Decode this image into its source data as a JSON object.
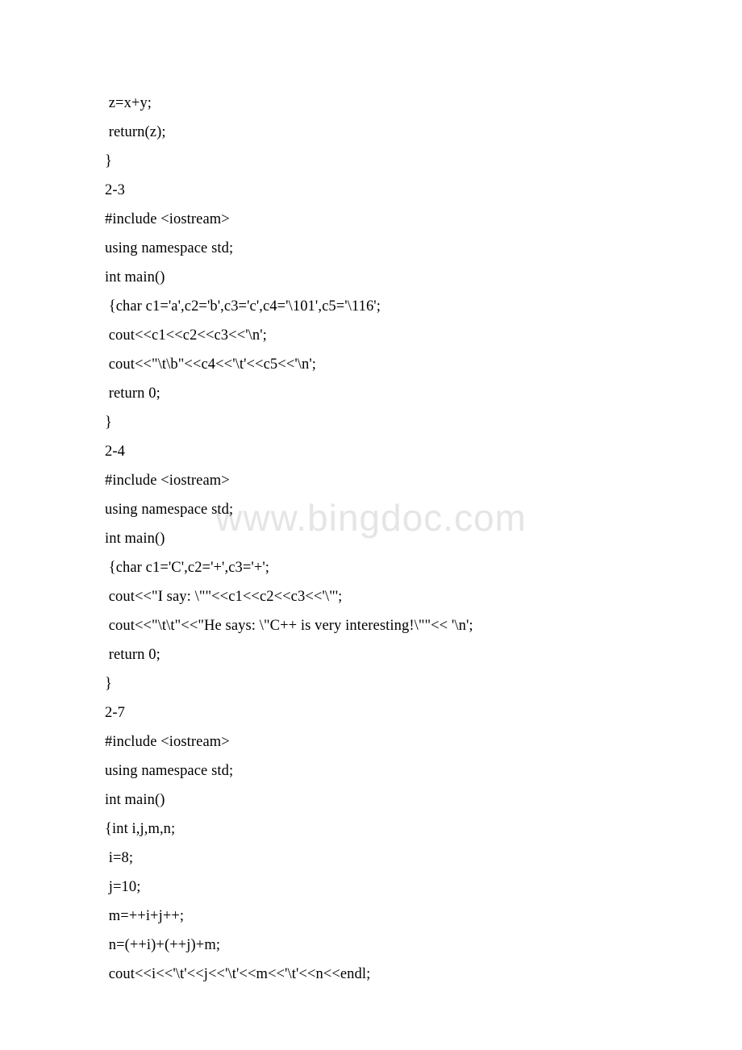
{
  "watermark": "www.bingdoc.com",
  "lines": [
    " z=x+y;",
    " return(z);",
    "}",
    "2-3",
    "#include <iostream>",
    "using namespace std;",
    "int main()",
    " {char c1='a',c2='b',c3='c',c4='\\101',c5='\\116';",
    " cout<<c1<<c2<<c3<<'\\n';",
    " cout<<\"\\t\\b\"<<c4<<'\\t'<<c5<<'\\n';",
    " return 0;",
    "}",
    "2-4",
    "#include <iostream>",
    "using namespace std;",
    "int main()",
    " {char c1='C',c2='+',c3='+';",
    " cout<<\"I say: \\\"\"<<c1<<c2<<c3<<'\\\"';",
    " cout<<\"\\t\\t\"<<\"He says: \\\"C++ is very interesting!\\\"\"<< '\\n';",
    " return 0;",
    "}",
    "2-7",
    "#include <iostream>",
    "using namespace std;",
    "int main()",
    "{int i,j,m,n;",
    " i=8;",
    " j=10;",
    " m=++i+j++;",
    " n=(++i)+(++j)+m;",
    " cout<<i<<'\\t'<<j<<'\\t'<<m<<'\\t'<<n<<endl;"
  ]
}
